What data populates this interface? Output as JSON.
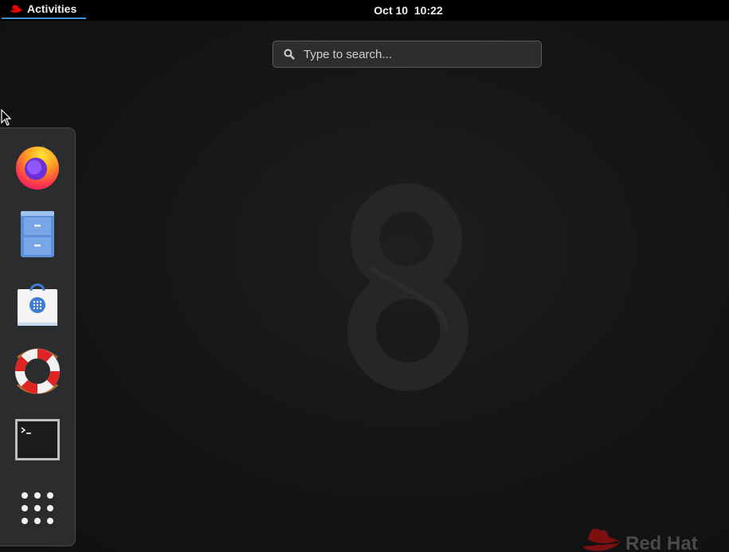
{
  "topbar": {
    "activities_label": "Activities",
    "clock_date": "Oct 10",
    "clock_time": "10:22"
  },
  "search": {
    "placeholder": "Type to search..."
  },
  "dash": {
    "items": [
      {
        "icon": "firefox-icon"
      },
      {
        "icon": "files-icon"
      },
      {
        "icon": "software-icon"
      },
      {
        "icon": "help-icon"
      },
      {
        "icon": "terminal-icon"
      },
      {
        "icon": "show-applications-icon"
      }
    ]
  },
  "wallpaper": {
    "brand_text": "Red Hat",
    "numeral": "8"
  },
  "colors": {
    "accent": "#3d8fd6",
    "redhat_red": "#ee0000",
    "panel_bg": "#000000",
    "dash_bg": "#2a2c2e"
  }
}
